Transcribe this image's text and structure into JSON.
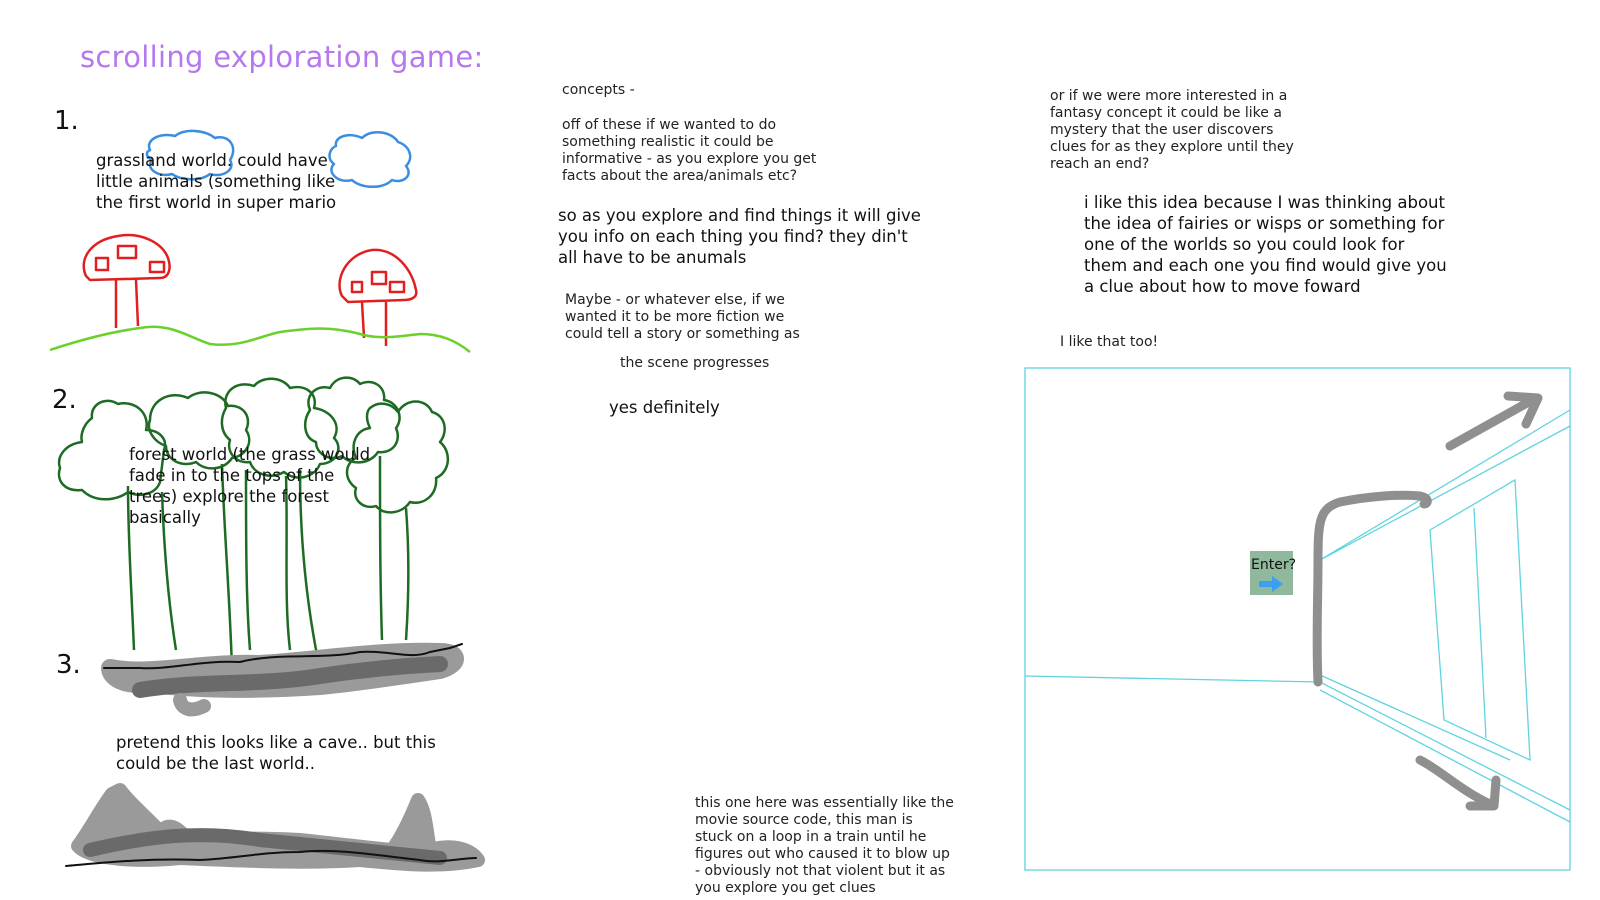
{
  "title": "scrolling exploration game:",
  "worlds": [
    {
      "number": "1.",
      "description": "grassland world. could have\nlittle animals (something like\nthe first world in super mario"
    },
    {
      "number": "2.",
      "description": "forest world (the grass would\nfade in to the tops of the\ntrees) explore the forest\nbasically"
    },
    {
      "number": "3.",
      "description": "pretend this looks like a cave.. but this\ncould be the last world.."
    }
  ],
  "notes": {
    "concepts_heading": "concepts -",
    "realistic": "off of these if we wanted to do\nsomething realistic it could be\ninformative - as you explore you get\nfacts about the area/animals etc?",
    "reply_info": "so as you explore and find things it will give\nyou info on each thing you find? they din't\nall have to be anumals",
    "fiction": "Maybe - or whatever else, if we\nwanted it to be more fiction we\ncould tell a story or something as",
    "fiction_cont": "the scene progresses",
    "yes": "yes definitely",
    "fantasy": "or if we were more interested in a\nfantasy concept it could be like a\nmystery that the user discovers\nclues for as they explore until they\nreach an end?",
    "fairies": "i like this idea because I was thinking about\nthe idea of fairies or wisps or something for\none of the worlds so you could look for\nthem and each one you find would give you\na clue about how to move foward",
    "like_too": "I like that too!",
    "source_code": "this one here was essentially like the\nmovie source code, this man is\nstuck on a loop in a train until he\nfigures out who caused it to blow up\n- obviously not that violent but it as\nyou explore you get clues"
  },
  "sketch": {
    "enter_label": "Enter?"
  },
  "colors": {
    "title": "#b678f0",
    "cloud": "#3a8de0",
    "mushroom": "#e02020",
    "grass": "#6ad12a",
    "forest": "#1e6b24",
    "cave": "#8a8a8a",
    "room": "#5fd3e0",
    "enter_bg": "#8fb89c",
    "enter_arrow": "#3aa0f0"
  }
}
